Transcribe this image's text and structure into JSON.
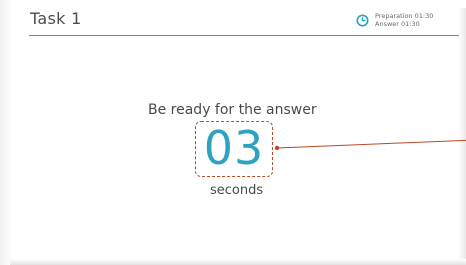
{
  "header": {
    "title": "Task 1",
    "timer": {
      "preparation": "Preparation 01:30",
      "answer": "Answer 01:30",
      "icon": "clock-icon"
    }
  },
  "main": {
    "prompt": "Be ready for the answer",
    "countdown": "03",
    "unit": "seconds"
  },
  "colors": {
    "accent": "#2ea3b3",
    "countdown": "#2ea3c0",
    "callout": "#b84a2a"
  }
}
